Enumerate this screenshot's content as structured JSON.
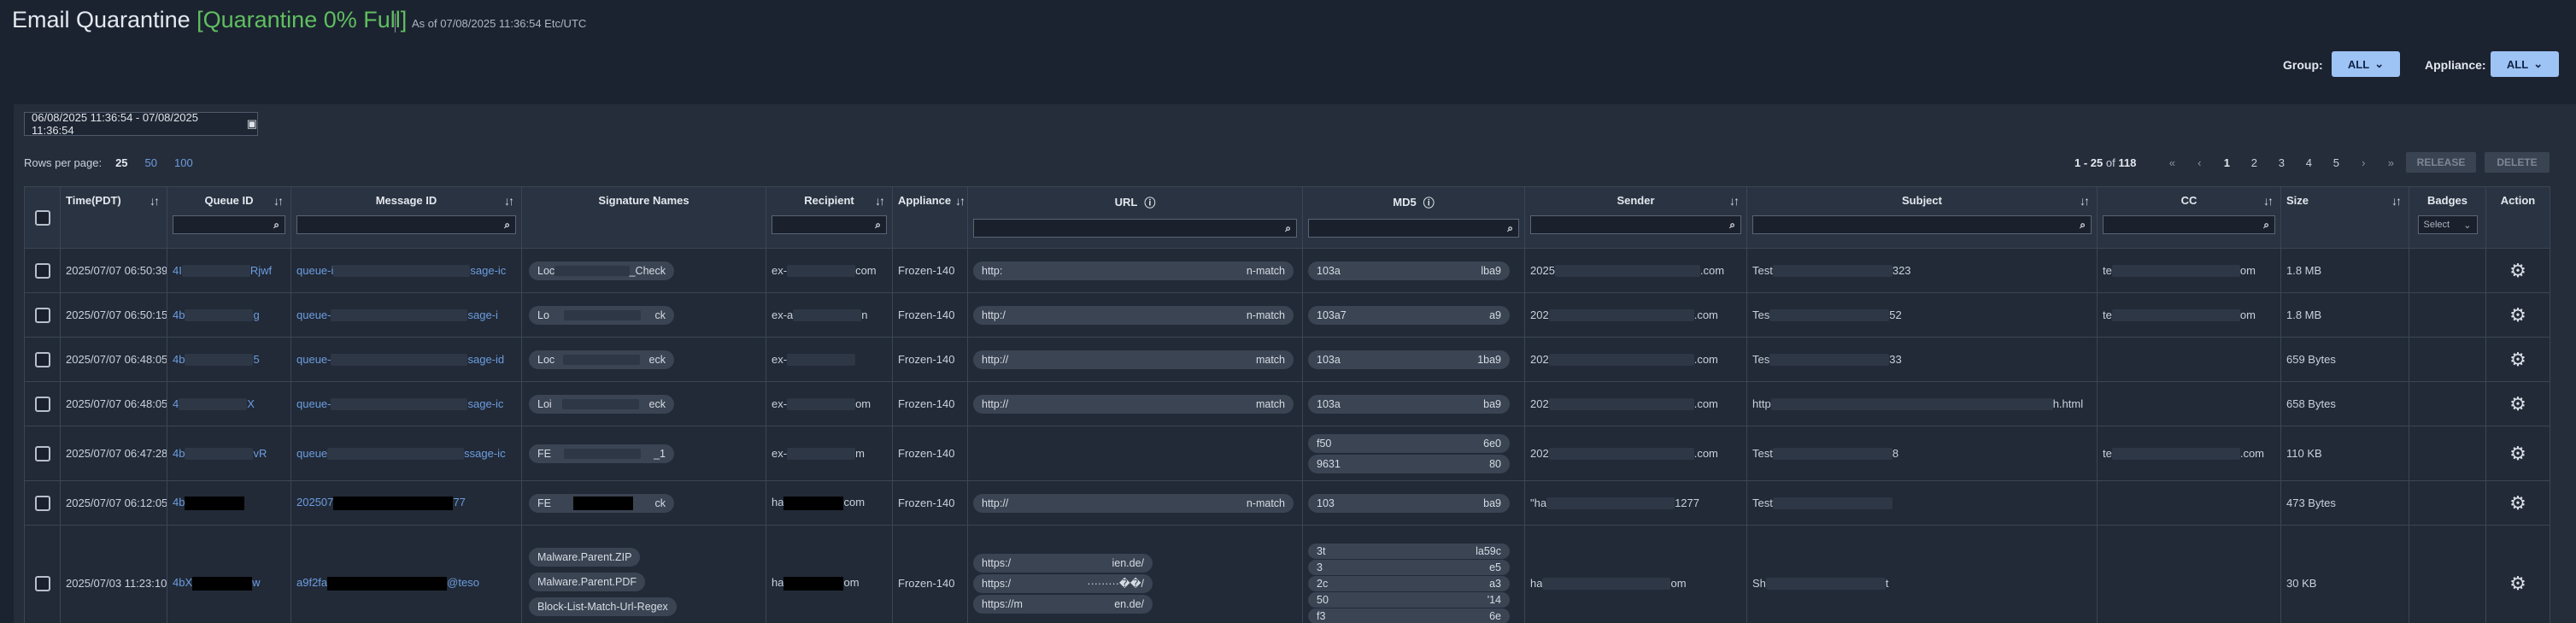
{
  "header": {
    "title": "Email Quarantine",
    "quarantine_status": "[Quarantine 0% Full]",
    "as_of": "As of 07/08/2025 11:36:54 Etc/UTC"
  },
  "filters": {
    "group_label": "Group:",
    "group_value": "ALL",
    "appliance_label": "Appliance:",
    "appliance_value": "ALL"
  },
  "date_range": "06/08/2025 11:36:54 - 07/08/2025 11:36:54",
  "rows_per_page": {
    "label": "Rows per page:",
    "options": [
      "25",
      "50",
      "100"
    ],
    "selected": "25"
  },
  "pagination": {
    "range": "1 - 25",
    "of_text": "of",
    "total": "118",
    "pages": [
      "1",
      "2",
      "3",
      "4",
      "5"
    ],
    "current": "1"
  },
  "actions": {
    "release": "RELEASE",
    "delete": "DELETE"
  },
  "columns": {
    "time": "Time(PDT)",
    "queue_id": "Queue ID",
    "message_id": "Message ID",
    "signature_names": "Signature Names",
    "recipient": "Recipient",
    "appliance": "Appliance",
    "url": "URL",
    "md5": "MD5",
    "sender": "Sender",
    "subject": "Subject",
    "cc": "CC",
    "size": "Size",
    "badges": "Badges",
    "action": "Action"
  },
  "badges_select": "Select",
  "rows": [
    {
      "time": "2025/07/07 06:50:39",
      "queue_id": "4I",
      "queue_id_end": "Rjwf",
      "message_id": "queue-i",
      "message_id_end": "sage-ic",
      "signatures": [
        [
          "Loc",
          "_Check"
        ]
      ],
      "recipient": "ex-",
      "recipient_end": "com",
      "appliance": "Frozen-140",
      "urls": [
        [
          "http:",
          "n-match"
        ]
      ],
      "md5s": [
        [
          "103a",
          "lba9"
        ]
      ],
      "sender": "2025",
      "sender_end": ".com",
      "subject": "Test",
      "subject_end": "323",
      "cc": "te",
      "cc_end": "om",
      "size": "1.8 MB"
    },
    {
      "time": "2025/07/07 06:50:15",
      "queue_id": "4b",
      "queue_id_end": "g",
      "message_id": "queue-",
      "message_id_end": "sage-i",
      "signatures": [
        [
          "Lo",
          "ck"
        ]
      ],
      "recipient": "ex-a",
      "recipient_end": "n",
      "appliance": "Frozen-140",
      "urls": [
        [
          "http:/",
          "n-match"
        ]
      ],
      "md5s": [
        [
          "103a7",
          "a9"
        ]
      ],
      "sender": "202",
      "sender_end": ".com",
      "subject": "Tes",
      "subject_end": "52",
      "cc": "te",
      "cc_end": "om",
      "size": "1.8 MB"
    },
    {
      "time": "2025/07/07 06:48:05",
      "queue_id": "4b",
      "queue_id_end": "5",
      "message_id": "queue-",
      "message_id_end": "sage-id",
      "signatures": [
        [
          "Loc",
          "eck"
        ]
      ],
      "recipient": "ex-",
      "recipient_end": "",
      "appliance": "Frozen-140",
      "urls": [
        [
          "http://",
          "match"
        ]
      ],
      "md5s": [
        [
          "103a",
          "1ba9"
        ]
      ],
      "sender": "202",
      "sender_end": ".com",
      "subject": "Tes",
      "subject_end": "33",
      "cc": "",
      "cc_end": "",
      "size": "659 Bytes"
    },
    {
      "time": "2025/07/07 06:48:05",
      "queue_id": "4",
      "queue_id_end": "X",
      "message_id": "queue-",
      "message_id_end": "sage-ic",
      "signatures": [
        [
          "Loi",
          "eck"
        ]
      ],
      "recipient": "ex-",
      "recipient_end": "om",
      "appliance": "Frozen-140",
      "urls": [
        [
          "http://",
          "match"
        ]
      ],
      "md5s": [
        [
          "103a",
          "ba9"
        ]
      ],
      "sender": "202",
      "sender_end": ".com",
      "subject": "http",
      "subject_end": "h.html",
      "cc": "",
      "cc_end": "",
      "size": "658 Bytes"
    },
    {
      "time": "2025/07/07 06:47:28",
      "queue_id": "4b",
      "queue_id_end": "vR",
      "message_id": "queue",
      "message_id_end": "ssage-ic",
      "signatures": [
        [
          "FE",
          "_1"
        ]
      ],
      "recipient": "ex-",
      "recipient_end": "m",
      "appliance": "Frozen-140",
      "urls": [],
      "md5s": [
        [
          "f50",
          "6e0"
        ],
        [
          "9631",
          "80"
        ]
      ],
      "sender": "202",
      "sender_end": ".com",
      "subject": "Test",
      "subject_end": "8",
      "cc": "te",
      "cc_end": ".com",
      "size": "110 KB"
    },
    {
      "time": "2025/07/07 06:12:05",
      "queue_id": "4b",
      "queue_id_end": "",
      "message_id": "202507",
      "message_id_end": "77",
      "signatures": [
        [
          "FE",
          "ck"
        ]
      ],
      "recipient": "ha",
      "recipient_end": "com",
      "appliance": "Frozen-140",
      "urls": [
        [
          "http://",
          "n-match"
        ]
      ],
      "md5s": [
        [
          "103",
          "ba9"
        ]
      ],
      "sender": "\"ha",
      "sender_end": "1277",
      "subject": "Test",
      "subject_end": "",
      "cc": "",
      "cc_end": "",
      "size": "473 Bytes"
    },
    {
      "time": "2025/07/03 11:23:10",
      "queue_id": "4bX",
      "queue_id_end": "w",
      "message_id": "a9f2fa",
      "message_id_end": "@teso",
      "signatures": [
        [
          "Malware.Parent.ZIP",
          ""
        ],
        [
          "Malware.Parent.PDF",
          ""
        ],
        [
          "Block-List-Match-Url-Regex",
          ""
        ]
      ],
      "recipient": "ha",
      "recipient_end": "om",
      "appliance": "Frozen-140",
      "urls": [
        [
          "https:/",
          "ien.de/"
        ],
        [
          "https:/",
          "·········��/"
        ],
        [
          "https://m",
          "en.de/"
        ]
      ],
      "md5s": [
        [
          "3t",
          "la59c"
        ],
        [
          "3",
          "e5"
        ],
        [
          "2c",
          "a3"
        ],
        [
          "50",
          "'14"
        ],
        [
          "f3",
          "6e"
        ]
      ],
      "sender": "ha",
      "sender_end": "om",
      "subject": "Sh",
      "subject_end": "t",
      "cc": "",
      "cc_end": "",
      "size": "30 KB"
    }
  ],
  "icons": {
    "calendar": "calendar-icon",
    "search": "search-icon",
    "gear": "gear-icon",
    "info": "info-icon",
    "sort": "sort-icon",
    "chevron": "chevron-down-icon"
  }
}
